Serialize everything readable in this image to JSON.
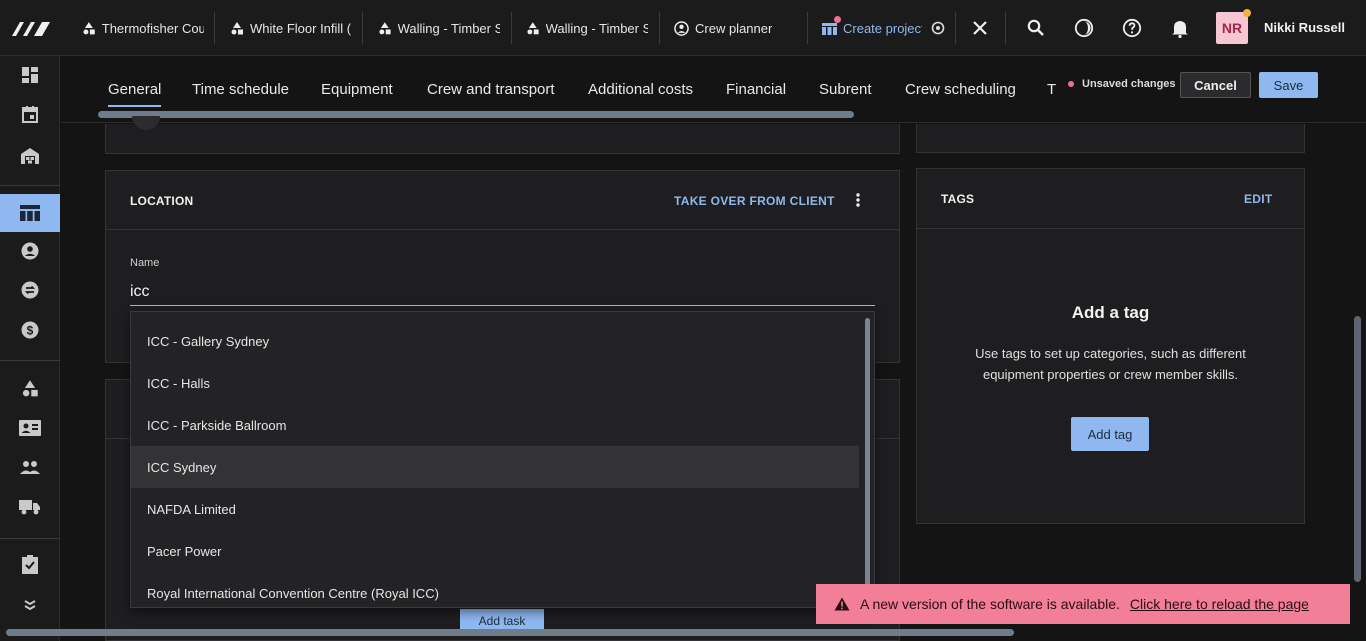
{
  "topbar": {
    "tabs": [
      {
        "label": "Thermofisher Cou",
        "icon": "shapes-icon"
      },
      {
        "label": "White Floor Infill (",
        "icon": "shapes-icon"
      },
      {
        "label": "Walling - Timber S",
        "icon": "shapes-icon"
      },
      {
        "label": "Walling - Timber S",
        "icon": "shapes-icon"
      },
      {
        "label": "Crew planner",
        "icon": "user-circle-icon"
      },
      {
        "label": "Create project",
        "icon": "project-board-icon",
        "active": true
      }
    ],
    "user": {
      "initials": "NR",
      "name": "Nikki Russell"
    }
  },
  "sidebar": {
    "items": [
      "dashboard-icon",
      "calendar-icon",
      "warehouse-icon",
      "projects-table-icon",
      "contact-icon",
      "swap-icon",
      "dollar-icon",
      "shapes-icon",
      "crew-card-icon",
      "people-icon",
      "truck-icon",
      "tasks-icon",
      "expand-more-icon"
    ]
  },
  "subtabs": [
    "General",
    "Time schedule",
    "Equipment",
    "Crew and transport",
    "Additional costs",
    "Financial",
    "Subrent",
    "Crew scheduling",
    "T"
  ],
  "actions": {
    "unsaved": "Unsaved changes",
    "cancel": "Cancel",
    "save": "Save"
  },
  "location": {
    "title": "LOCATION",
    "take_over": "TAKE OVER FROM CLIENT",
    "name_label": "Name",
    "name_value": "icc",
    "options": [
      "ICC - Gallery Sydney",
      "ICC - Halls",
      "ICC - Parkside Ballroom",
      "ICC Sydney",
      "NAFDA Limited",
      "Pacer Power",
      "Royal International Convention Centre (Royal ICC)"
    ],
    "highlighted": "ICC Sydney"
  },
  "tags": {
    "title": "TAGS",
    "edit": "EDIT",
    "empty_title": "Add a tag",
    "empty_desc": "Use tags to set up categories, such as different equipment properties or crew member skills.",
    "add_button": "Add tag"
  },
  "tasks": {
    "add_button": "Add task"
  },
  "toast": {
    "message": "A new version of the software is available.",
    "link": "Click here to reload the page"
  },
  "colors": {
    "accent": "#8fb8f0",
    "toast": "#f27e98",
    "unsaved_dot": "#ef6e8e",
    "avatar_bg": "#f6c6d4"
  }
}
